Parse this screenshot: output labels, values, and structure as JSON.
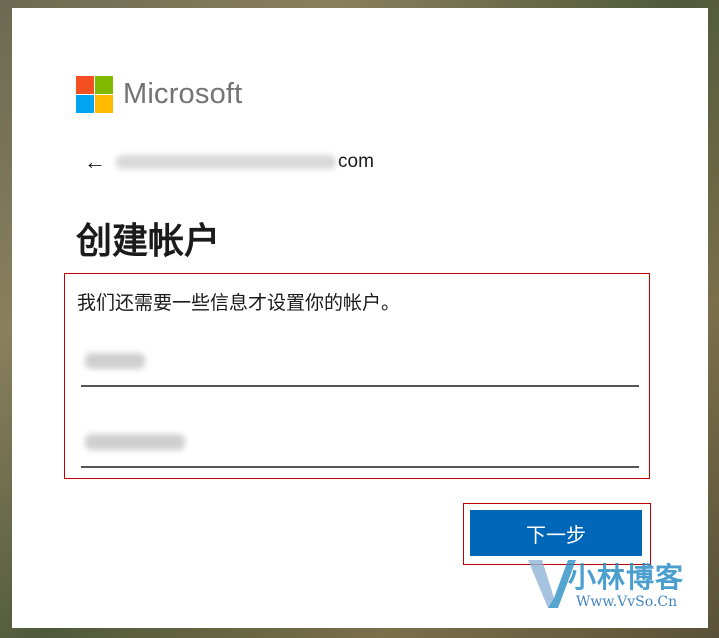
{
  "logo": {
    "text": "Microsoft",
    "colors": [
      "#f25022",
      "#7fba00",
      "#00a4ef",
      "#ffb900"
    ]
  },
  "back": {
    "icon": "left-arrow-icon",
    "arrow_glyph": "←",
    "email_suffix": "com"
  },
  "title": "创建帐户",
  "instruction": "我们还需要一些信息才设置你的帐户。",
  "fields": [
    {
      "name": "last-name",
      "value": ""
    },
    {
      "name": "first-name",
      "value": ""
    }
  ],
  "next_button": {
    "label": "下一步",
    "color": "#0067b8"
  },
  "watermark": {
    "text": "小林博客",
    "url": "Www.VvSo.Cn"
  }
}
